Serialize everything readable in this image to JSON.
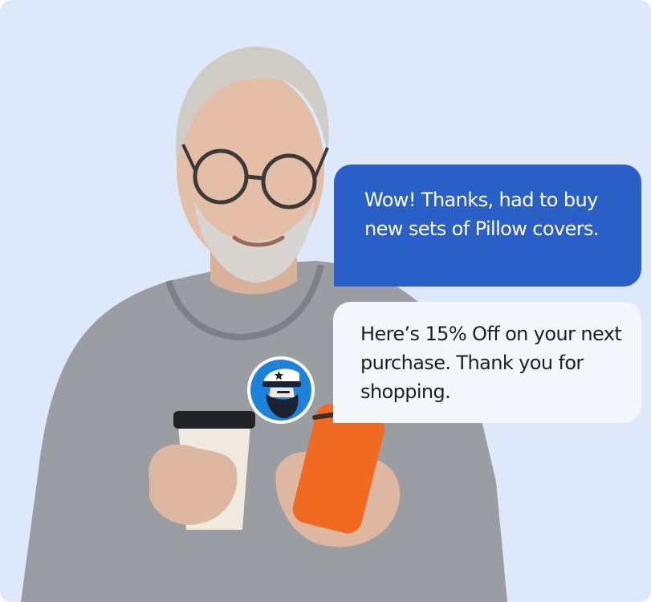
{
  "chat": {
    "messages": [
      {
        "role": "customer",
        "text": "Wow! Thanks, had to buy new sets of Pillow covers."
      },
      {
        "role": "brand",
        "text": "Here’s 15% Off on your next purchase. Thank you for shopping."
      }
    ]
  },
  "colors": {
    "background": "#dde9fb",
    "customer_bubble": "#2b5fc8",
    "brand_bubble": "#f3f6fb",
    "avatar_ring": "#1e82d8",
    "phone": "#f06a22",
    "sweater": "#9a9da2"
  },
  "icons": {
    "brand_avatar": "sailor-captain-icon"
  }
}
